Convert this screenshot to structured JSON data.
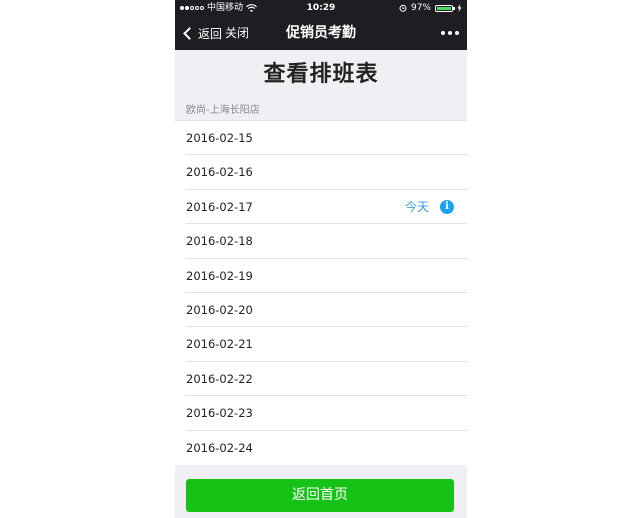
{
  "status_bar": {
    "carrier": "中国移动",
    "time": "10:29",
    "battery_percent": "97%",
    "battery_level": 0.97
  },
  "nav": {
    "back_label": "返回",
    "close_label": "关闭",
    "title": "促销员考勤"
  },
  "page": {
    "heading": "查看排班表",
    "store": "欧尚-上海长阳店"
  },
  "schedule": [
    {
      "date": "2016-02-15"
    },
    {
      "date": "2016-02-16"
    },
    {
      "date": "2016-02-17",
      "badge": "今天"
    },
    {
      "date": "2016-02-18"
    },
    {
      "date": "2016-02-19"
    },
    {
      "date": "2016-02-20"
    },
    {
      "date": "2016-02-21"
    },
    {
      "date": "2016-02-22"
    },
    {
      "date": "2016-02-23"
    },
    {
      "date": "2016-02-24"
    }
  ],
  "footer": {
    "home_button": "返回首页"
  },
  "colors": {
    "accent_green": "#17c217",
    "today_blue": "#3b9ad9",
    "info_blue": "#1aa1f0"
  }
}
